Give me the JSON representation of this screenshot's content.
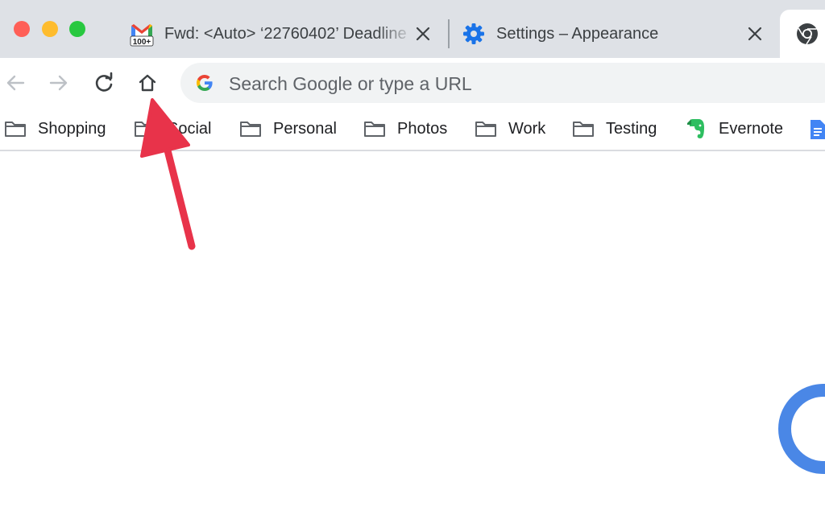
{
  "window": {
    "controls": [
      "close",
      "minimize",
      "zoom"
    ]
  },
  "tabs": [
    {
      "title": "Fwd: <Auto> ‘22760402’ Deadline",
      "favicon": "gmail-icon",
      "badge": "100+"
    },
    {
      "title": "Settings – Appearance",
      "favicon": "settings-gear-icon"
    },
    {
      "title": "",
      "favicon": "chrome-icon",
      "active": true
    }
  ],
  "omnibox": {
    "value": "",
    "placeholder": "Search Google or type a URL",
    "icon": "google-g-icon"
  },
  "bookmarks": [
    {
      "label": "Shopping",
      "icon": "folder-icon"
    },
    {
      "label": "Social",
      "icon": "folder-icon"
    },
    {
      "label": "Personal",
      "icon": "folder-icon"
    },
    {
      "label": "Photos",
      "icon": "folder-icon"
    },
    {
      "label": "Work",
      "icon": "folder-icon"
    },
    {
      "label": "Testing",
      "icon": "folder-icon"
    },
    {
      "label": "Evernote",
      "icon": "evernote-icon"
    }
  ],
  "colors": {
    "tabstrip": "#dee1e6",
    "annotation_arrow": "#e8334a",
    "spinner": "#4a87e6"
  }
}
